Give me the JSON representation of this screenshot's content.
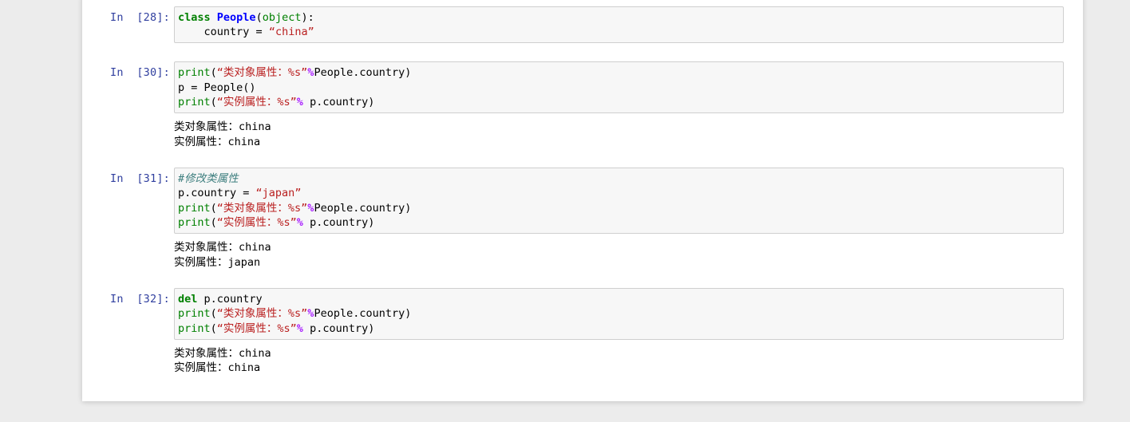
{
  "page": {
    "background_color": "#ececec",
    "paper_color": "#ffffff"
  },
  "theme": {
    "input_background": "#f7f7f7",
    "input_border": "#cfcfcf",
    "prompt_color": "#303F9F",
    "keyword_color": "#008000",
    "class_name_color": "#0000FF",
    "builtin_color": "#008000",
    "string_color": "#BA2121",
    "percent_operator_color": "#AA22FF",
    "comment_color": "#408080",
    "output_text_color": "#000000"
  },
  "cells": [
    {
      "prompt": "In  [28]:",
      "execution_count": 28,
      "code_lines": [
        [
          {
            "t": "class",
            "c": "tok-k"
          },
          {
            "t": " ",
            "c": "tok-p"
          },
          {
            "t": "People",
            "c": "tok-nc"
          },
          {
            "t": "(",
            "c": "tok-p"
          },
          {
            "t": "object",
            "c": "tok-nb"
          },
          {
            "t": "):",
            "c": "tok-p"
          }
        ],
        [
          {
            "t": "    country ",
            "c": "tok-p"
          },
          {
            "t": "=",
            "c": "tok-p"
          },
          {
            "t": " ",
            "c": "tok-p"
          },
          {
            "t": "“china”",
            "c": "tok-s"
          }
        ]
      ],
      "output": null
    },
    {
      "prompt": "In  [30]:",
      "execution_count": 30,
      "code_lines": [
        [
          {
            "t": "print",
            "c": "tok-nf"
          },
          {
            "t": "(",
            "c": "tok-p"
          },
          {
            "t": "“类对象属性：%s”",
            "c": "tok-s"
          },
          {
            "t": "%",
            "c": "tok-op"
          },
          {
            "t": "People.country)",
            "c": "tok-p"
          }
        ],
        [
          {
            "t": "p = People()",
            "c": "tok-p"
          }
        ],
        [
          {
            "t": "print",
            "c": "tok-nf"
          },
          {
            "t": "(",
            "c": "tok-p"
          },
          {
            "t": "“实例属性：%s”",
            "c": "tok-s"
          },
          {
            "t": "%",
            "c": "tok-op"
          },
          {
            "t": " p.country)",
            "c": "tok-p"
          }
        ]
      ],
      "output": "类对象属性：china\n实例属性：china"
    },
    {
      "prompt": "In  [31]:",
      "execution_count": 31,
      "code_lines": [
        [
          {
            "t": "#修改类属性",
            "c": "tok-c"
          }
        ],
        [
          {
            "t": "p.country = ",
            "c": "tok-p"
          },
          {
            "t": "“japan”",
            "c": "tok-s"
          }
        ],
        [
          {
            "t": "print",
            "c": "tok-nf"
          },
          {
            "t": "(",
            "c": "tok-p"
          },
          {
            "t": "“类对象属性：%s”",
            "c": "tok-s"
          },
          {
            "t": "%",
            "c": "tok-op"
          },
          {
            "t": "People.country)",
            "c": "tok-p"
          }
        ],
        [
          {
            "t": "print",
            "c": "tok-nf"
          },
          {
            "t": "(",
            "c": "tok-p"
          },
          {
            "t": "“实例属性：%s”",
            "c": "tok-s"
          },
          {
            "t": "%",
            "c": "tok-op"
          },
          {
            "t": " p.country)",
            "c": "tok-p"
          }
        ]
      ],
      "output": "类对象属性：china\n实例属性：japan"
    },
    {
      "prompt": "In  [32]:",
      "execution_count": 32,
      "code_lines": [
        [
          {
            "t": "del",
            "c": "tok-k"
          },
          {
            "t": " p.country",
            "c": "tok-p"
          }
        ],
        [
          {
            "t": "print",
            "c": "tok-nf"
          },
          {
            "t": "(",
            "c": "tok-p"
          },
          {
            "t": "“类对象属性：%s”",
            "c": "tok-s"
          },
          {
            "t": "%",
            "c": "tok-op"
          },
          {
            "t": "People.country)",
            "c": "tok-p"
          }
        ],
        [
          {
            "t": "print",
            "c": "tok-nf"
          },
          {
            "t": "(",
            "c": "tok-p"
          },
          {
            "t": "“实例属性：%s”",
            "c": "tok-s"
          },
          {
            "t": "%",
            "c": "tok-op"
          },
          {
            "t": " p.country)",
            "c": "tok-p"
          }
        ]
      ],
      "output": "类对象属性：china\n实例属性：china"
    }
  ]
}
